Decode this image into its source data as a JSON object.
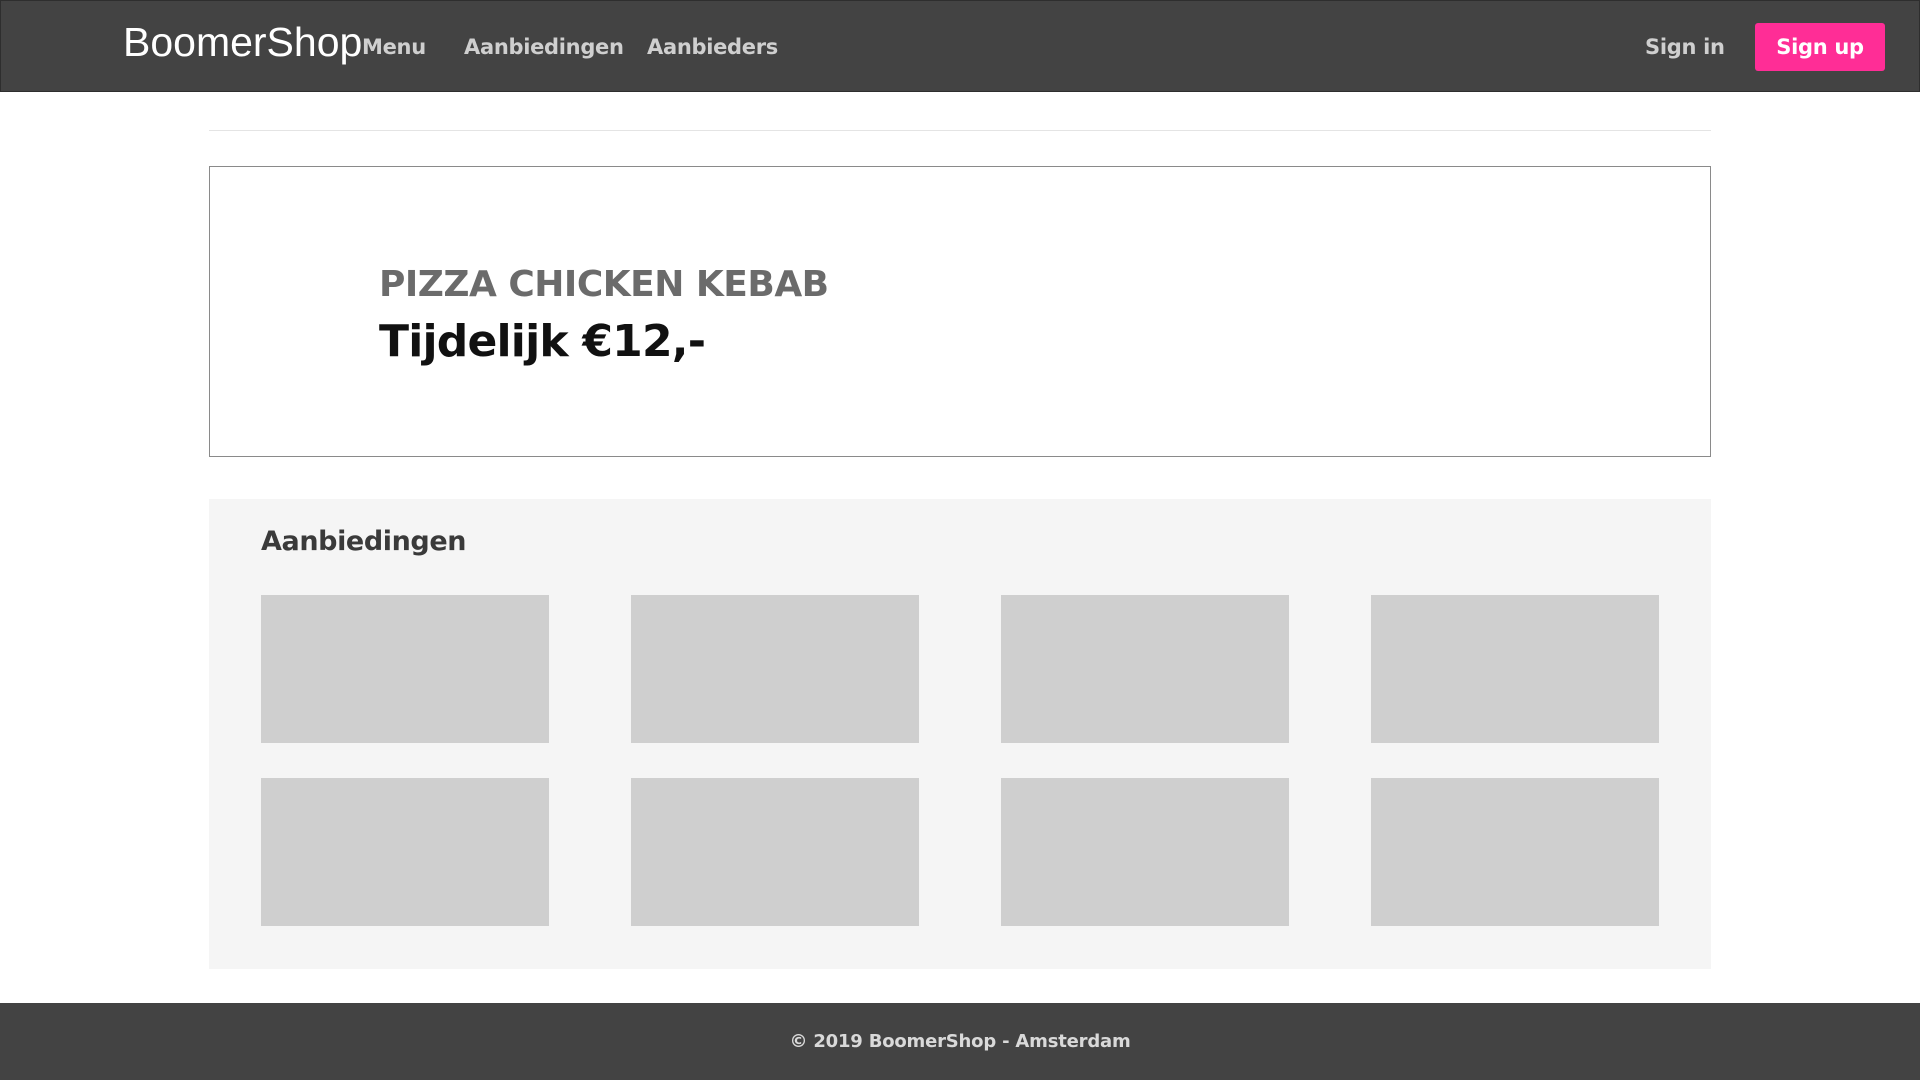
{
  "navbar": {
    "brand": "BoomerShop",
    "links": {
      "menu": "Menu",
      "offers": "Aanbiedingen",
      "providers": "Aanbieders"
    },
    "sign_in": "Sign in",
    "sign_up": "Sign up"
  },
  "hero": {
    "subtitle": "PIZZA CHICKEN KEBAB",
    "title": "Tijdelijk €12,-"
  },
  "offers": {
    "heading": "Aanbiedingen",
    "cards": [
      {
        "id": 1
      },
      {
        "id": 2
      },
      {
        "id": 3
      },
      {
        "id": 4
      },
      {
        "id": 5
      },
      {
        "id": 6
      },
      {
        "id": 7
      },
      {
        "id": 8
      }
    ]
  },
  "footer": {
    "text": "© 2019 BoomerShop - Amsterdam"
  },
  "colors": {
    "navbar_bg": "#434343",
    "accent": "#ff2d96",
    "card_placeholder": "#cfcfcf",
    "section_bg": "#f5f5f5"
  }
}
